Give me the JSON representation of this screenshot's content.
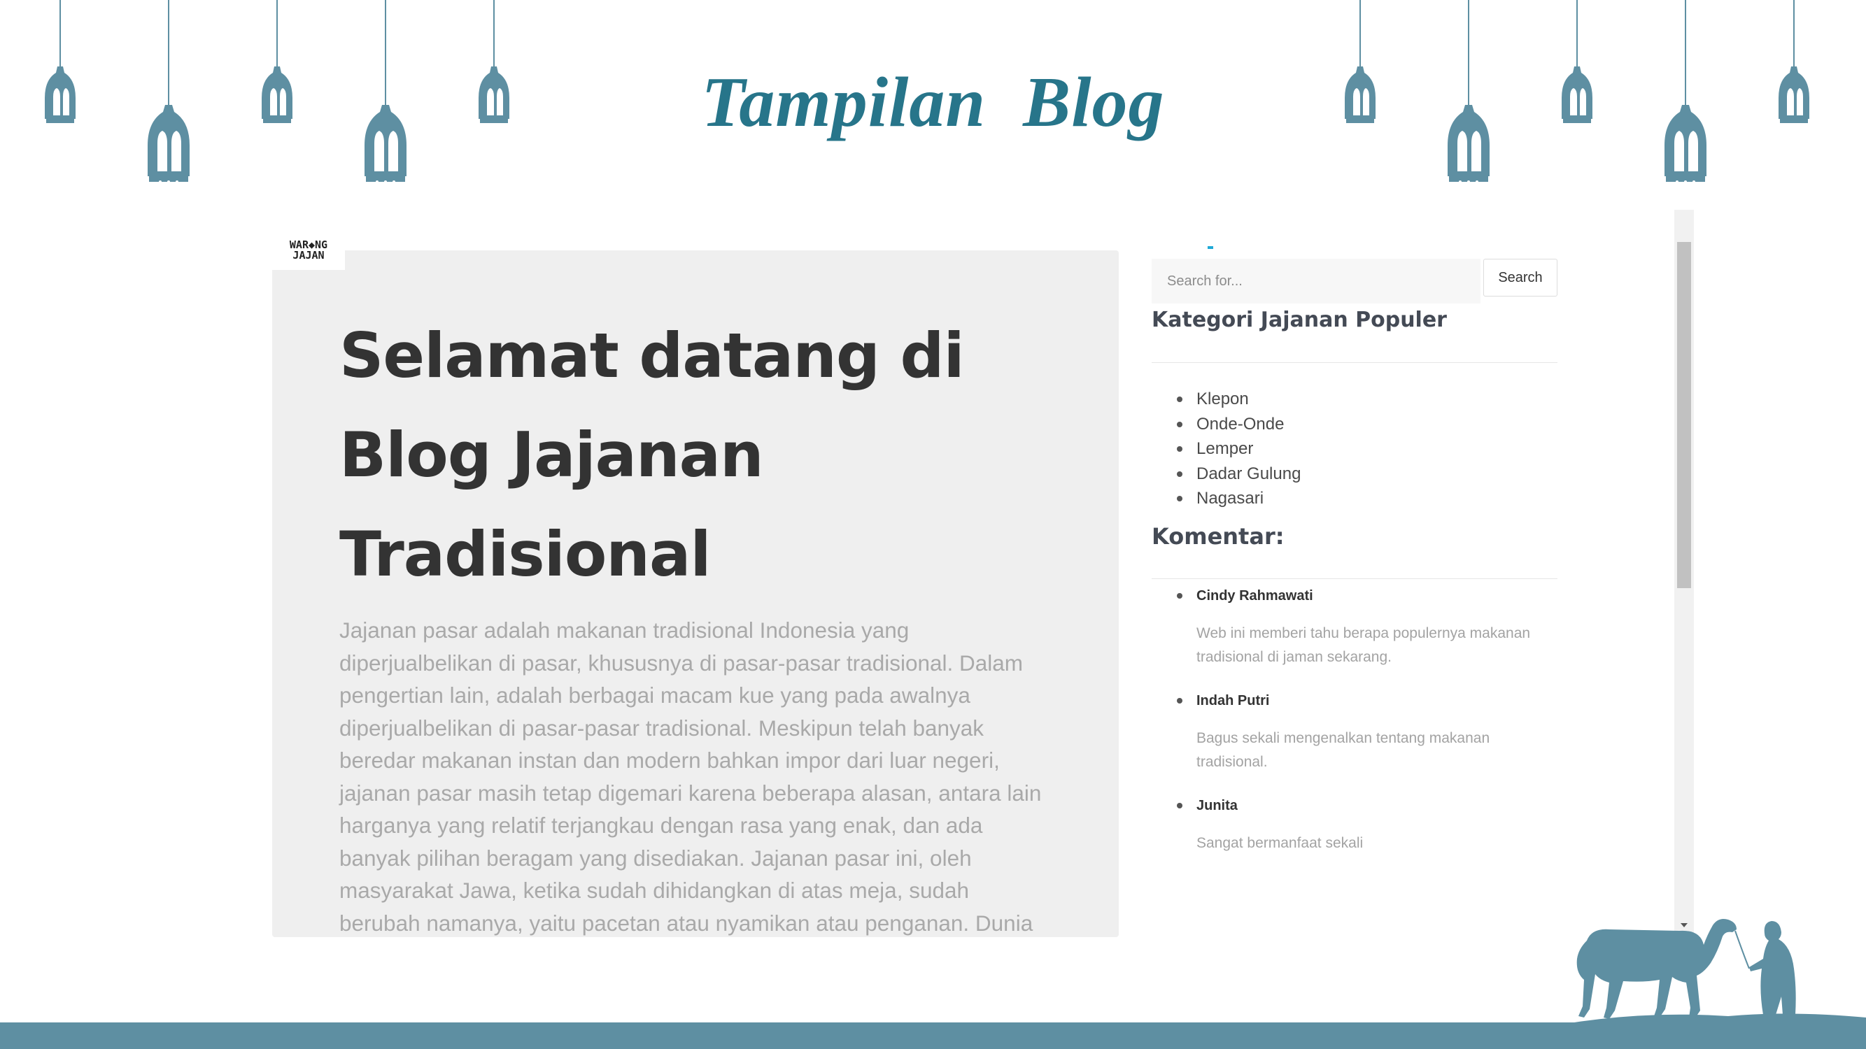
{
  "slide": {
    "title": "Tampilan  Blog",
    "accent_color": "#27758a",
    "decor_color": "#5e8fa2"
  },
  "site": {
    "logo": {
      "line1": "WAR◆NG",
      "line2": "JAJAN"
    },
    "hero": {
      "title": "Selamat datang di Blog Jajanan Tradisional",
      "paragraph": "Jajanan pasar adalah makanan tradisional Indonesia yang diperjualbelikan di pasar, khususnya di pasar-pasar tradisional. Dalam pengertian lain, adalah berbagai macam kue yang pada awalnya diperjualbelikan di pasar-pasar tradisional. Meskipun telah banyak beredar makanan instan dan modern bahkan impor dari luar negeri, jajanan pasar masih tetap digemari karena beberapa alasan, antara lain harganya yang relatif terjangkau dengan rasa yang enak, dan ada banyak pilihan beragam yang disediakan. Jajanan pasar ini, oleh masyarakat Jawa, ketika sudah dihidangkan di atas meja, sudah berubah namanya, yaitu pacetan atau nyamikan atau penganan. Dunia"
    },
    "sidebar": {
      "search": {
        "placeholder": "Search for...",
        "button": "Search"
      },
      "categories_title": "Kategori Jajanan Populer",
      "categories": [
        "Klepon",
        "Onde-Onde",
        "Lemper",
        "Dadar Gulung",
        "Nagasari"
      ],
      "comments_title": "Komentar:",
      "comments": [
        {
          "name": "Cindy Rahmawati",
          "text": "Web ini memberi tahu berapa populernya makanan tradisional di jaman sekarang."
        },
        {
          "name": "Indah Putri",
          "text": "Bagus sekali mengenalkan tentang makanan tradisional."
        },
        {
          "name": "Junita",
          "text": "Sangat bermanfaat sekali"
        }
      ]
    }
  },
  "icons": [
    "hanging-lantern-icon",
    "camel-traveler-icon",
    "scroll-down-arrow-icon"
  ]
}
